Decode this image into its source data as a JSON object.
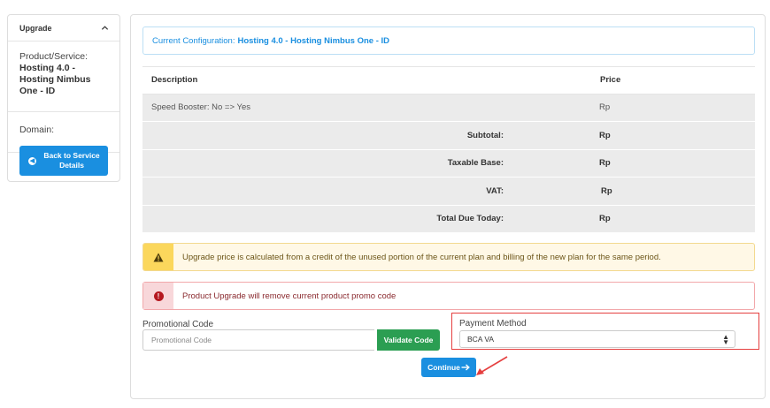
{
  "sidebar": {
    "title": "Upgrade",
    "product_label": "Product/Service:",
    "product_value": "Hosting 4.0 - Hosting Nimbus One - ID",
    "domain_label": "Domain:",
    "back_button": "Back to Service Details"
  },
  "config": {
    "label": "Current Configuration:",
    "value": "Hosting 4.0 - Hosting Nimbus One - ID"
  },
  "table": {
    "headers": {
      "description": "Description",
      "price": "Price"
    },
    "item": {
      "description": "Speed Booster: No => Yes",
      "price": "Rp"
    },
    "totals": [
      {
        "label": "Subtotal:",
        "value": "Rp"
      },
      {
        "label": "Taxable Base:",
        "value": "Rp"
      },
      {
        "label": "VAT:",
        "value": "Rp"
      },
      {
        "label": "Total Due Today:",
        "value": "Rp"
      }
    ]
  },
  "alerts": {
    "warning": "Upgrade price is calculated from a credit of the unused portion of the current plan and billing of the new plan for the same period.",
    "danger": "Product Upgrade will remove current product promo code"
  },
  "promo": {
    "label": "Promotional Code",
    "placeholder": "Promotional Code",
    "validate_button": "Validate Code"
  },
  "payment": {
    "label": "Payment Method",
    "selected": "BCA VA"
  },
  "continue_button": "Continue",
  "colors": {
    "primary": "#1a8fe0",
    "success": "#2b9e52",
    "warning": "#fbd75c",
    "danger": "#b5181f",
    "annotation": "#e53f3f"
  }
}
